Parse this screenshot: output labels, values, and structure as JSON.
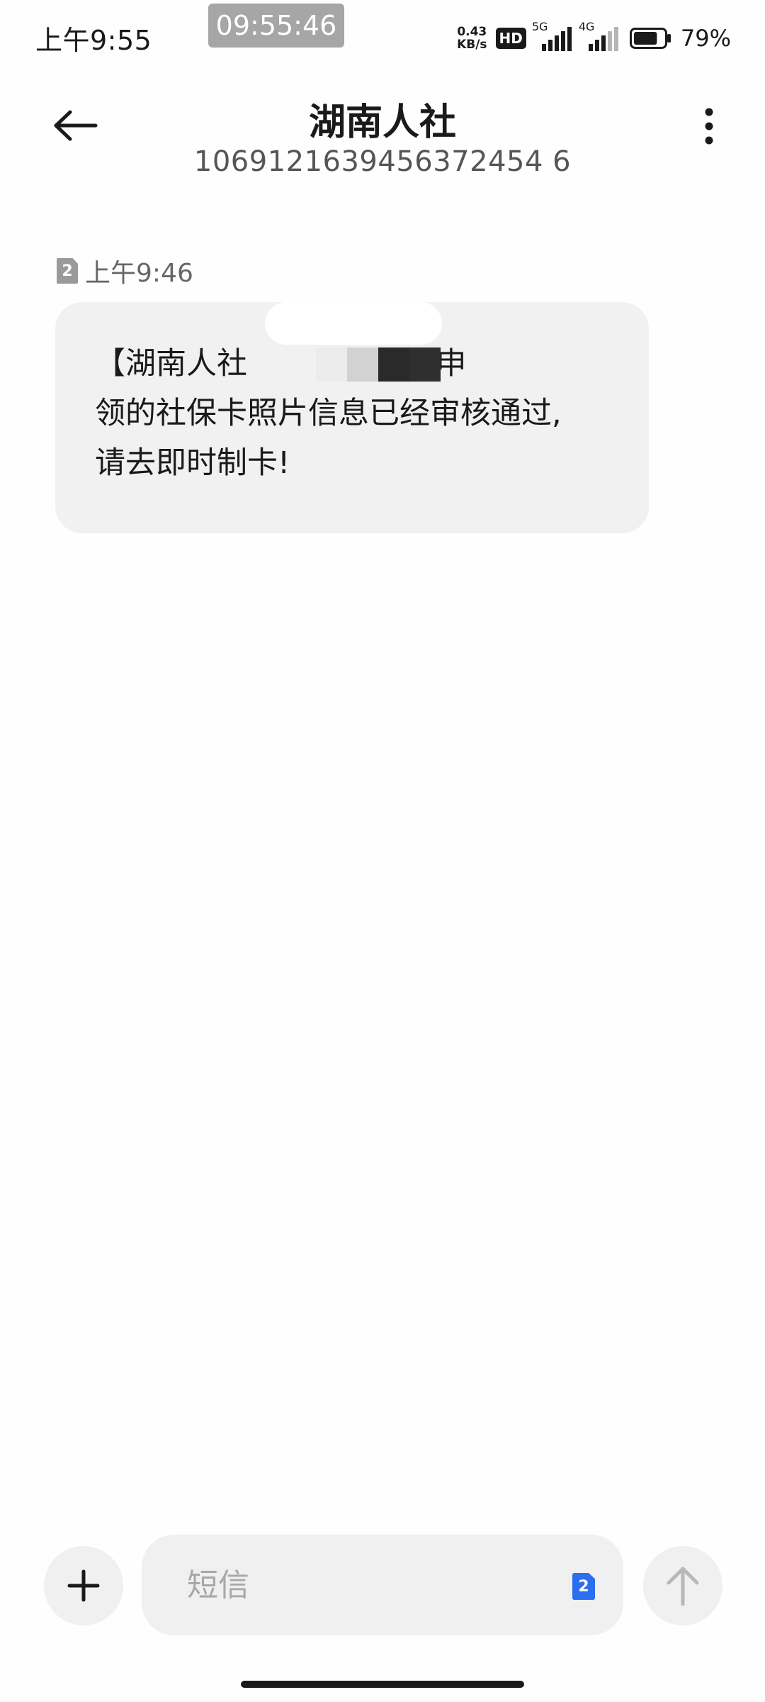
{
  "status_bar": {
    "time": "上午9:55",
    "recorder_time": "09:55:46",
    "net_speed_value": "0.43",
    "net_speed_unit": "KB/s",
    "hd_label": "HD",
    "sim1_network": "5G",
    "sim2_network": "4G",
    "battery_percent": "79%",
    "battery_level": 0.79
  },
  "header": {
    "title": "湖南人社",
    "phone_number": "1069121639456372454 6"
  },
  "message": {
    "sim_slot": "2",
    "time": "上午9:46",
    "body": "【湖南人社        /女士,您申\n领的社保卡照片信息已经审核通过,\n请去即时制卡!"
  },
  "composer": {
    "placeholder": "短信",
    "sim_slot": "2"
  },
  "icons": {
    "back": "arrow-left-icon",
    "more": "more-vertical-icon",
    "add": "plus-icon",
    "send": "arrow-up-icon"
  },
  "colors": {
    "bubble_bg": "#f1f1f1",
    "sim_badge_gray": "#9a9a9a",
    "sim_badge_blue": "#2b6ef0",
    "recorder_pill": "#a6a6a6"
  }
}
